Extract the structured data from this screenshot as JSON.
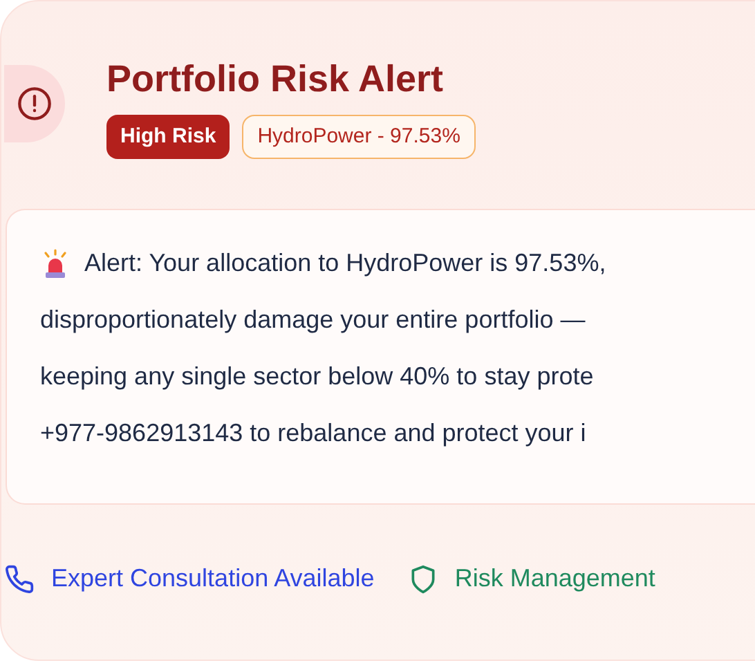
{
  "alert": {
    "title": "Portfolio Risk Alert",
    "badges": [
      {
        "kind": "solid",
        "label": "High Risk"
      },
      {
        "kind": "outline",
        "label": "HydroPower - 97.53%"
      }
    ],
    "message_lines": [
      "Alert: Your allocation to HydroPower is 97.53%,",
      "disproportionately damage your entire portfolio —",
      "keeping any single sector below 40% to stay prote",
      "+977-9862913143 to rebalance and protect your i"
    ],
    "footer": [
      {
        "kind": "phone",
        "label": "Expert Consultation Available"
      },
      {
        "kind": "shield",
        "label": "Risk Management"
      }
    ]
  }
}
